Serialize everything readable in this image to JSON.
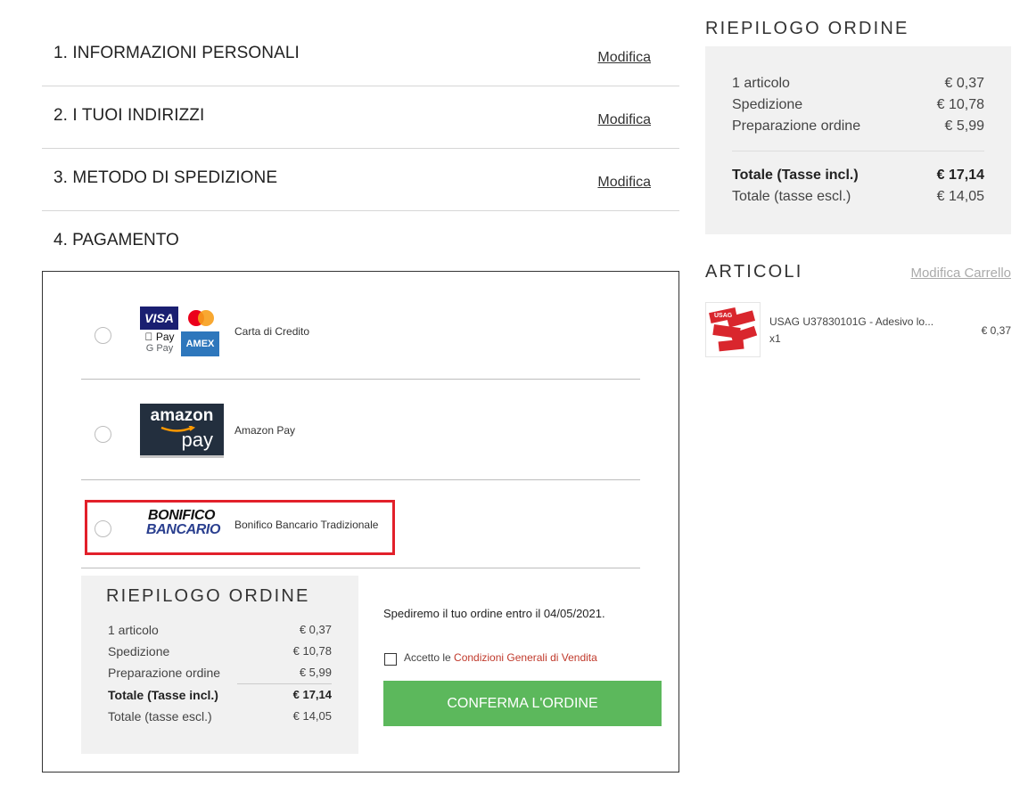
{
  "steps": [
    {
      "title": "1. INFORMAZIONI PERSONALI",
      "edit": "Modifica"
    },
    {
      "title": "2. I TUOI INDIRIZZI",
      "edit": "Modifica"
    },
    {
      "title": "3. METODO DI SPEDIZIONE",
      "edit": "Modifica"
    },
    {
      "title": "4. PAGAMENTO"
    }
  ],
  "payment": {
    "card": {
      "label": "Carta di Credito",
      "logo_visa": "VISA",
      "logo_applepay": "Pay",
      "logo_gpay": "G Pay",
      "logo_amex": "AMEX"
    },
    "amazon": {
      "label": "Amazon Pay",
      "logo_top": "amazon",
      "logo_bottom": "pay"
    },
    "bank": {
      "label": "Bonifico Bancario Tradizionale",
      "logo_top": "BONIFICO",
      "logo_bottom": "BANCARIO"
    }
  },
  "summary": {
    "title": "RIEPILOGO ORDINE",
    "rows": [
      {
        "label": "1 articolo",
        "value": "€ 0,37"
      },
      {
        "label": "Spedizione",
        "value": "€ 10,78"
      },
      {
        "label": "Preparazione ordine",
        "value": "€ 5,99"
      }
    ],
    "total_incl": {
      "label": "Totale (Tasse incl.)",
      "value": "€ 17,14"
    },
    "total_excl": {
      "label": "Totale (tasse escl.)",
      "value": "€ 14,05"
    }
  },
  "shipping_note": "Spediremo il tuo ordine entro il 04/05/2021.",
  "terms": {
    "prefix": "Accetto le ",
    "link": "Condizioni Generali di Vendita"
  },
  "confirm_label": "CONFERMA L'ORDINE",
  "articles": {
    "title": "ARTICOLI",
    "edit_cart": "Modifica Carrello",
    "items": [
      {
        "name": "USAG U37830101G - Adesivo lo...",
        "qty": "x1",
        "price": "€ 0,37",
        "thumb_text": "USAG"
      }
    ]
  },
  "colors": {
    "confirm": "#5cb85c",
    "highlight": "#e2202a",
    "link_red": "#c0392b",
    "visa_blue": "#1a1f71",
    "amex_blue": "#2e77bc"
  }
}
